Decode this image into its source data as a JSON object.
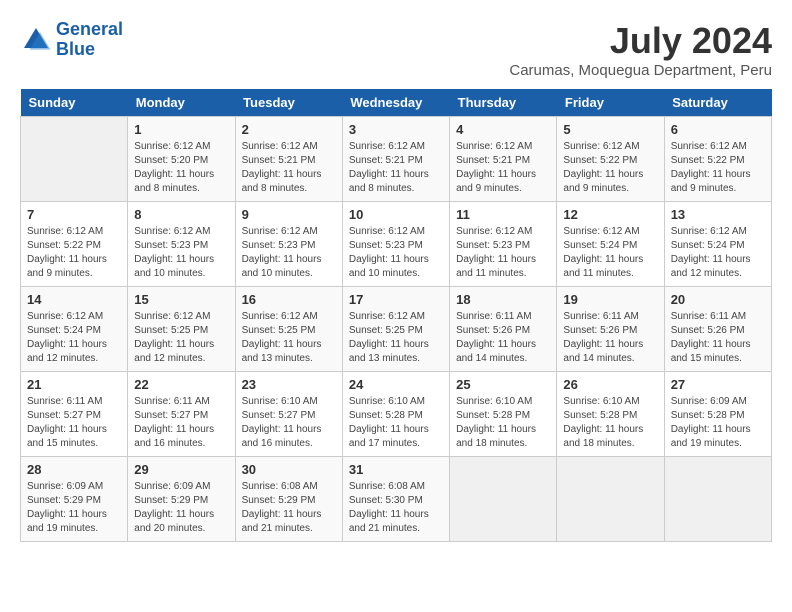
{
  "header": {
    "logo_general": "General",
    "logo_blue": "Blue",
    "month": "July 2024",
    "location": "Carumas, Moquegua Department, Peru"
  },
  "weekdays": [
    "Sunday",
    "Monday",
    "Tuesday",
    "Wednesday",
    "Thursday",
    "Friday",
    "Saturday"
  ],
  "weeks": [
    [
      {
        "day": "",
        "info": ""
      },
      {
        "day": "1",
        "info": "Sunrise: 6:12 AM\nSunset: 5:20 PM\nDaylight: 11 hours\nand 8 minutes."
      },
      {
        "day": "2",
        "info": "Sunrise: 6:12 AM\nSunset: 5:21 PM\nDaylight: 11 hours\nand 8 minutes."
      },
      {
        "day": "3",
        "info": "Sunrise: 6:12 AM\nSunset: 5:21 PM\nDaylight: 11 hours\nand 8 minutes."
      },
      {
        "day": "4",
        "info": "Sunrise: 6:12 AM\nSunset: 5:21 PM\nDaylight: 11 hours\nand 9 minutes."
      },
      {
        "day": "5",
        "info": "Sunrise: 6:12 AM\nSunset: 5:22 PM\nDaylight: 11 hours\nand 9 minutes."
      },
      {
        "day": "6",
        "info": "Sunrise: 6:12 AM\nSunset: 5:22 PM\nDaylight: 11 hours\nand 9 minutes."
      }
    ],
    [
      {
        "day": "7",
        "info": "Sunrise: 6:12 AM\nSunset: 5:22 PM\nDaylight: 11 hours\nand 9 minutes."
      },
      {
        "day": "8",
        "info": "Sunrise: 6:12 AM\nSunset: 5:23 PM\nDaylight: 11 hours\nand 10 minutes."
      },
      {
        "day": "9",
        "info": "Sunrise: 6:12 AM\nSunset: 5:23 PM\nDaylight: 11 hours\nand 10 minutes."
      },
      {
        "day": "10",
        "info": "Sunrise: 6:12 AM\nSunset: 5:23 PM\nDaylight: 11 hours\nand 10 minutes."
      },
      {
        "day": "11",
        "info": "Sunrise: 6:12 AM\nSunset: 5:23 PM\nDaylight: 11 hours\nand 11 minutes."
      },
      {
        "day": "12",
        "info": "Sunrise: 6:12 AM\nSunset: 5:24 PM\nDaylight: 11 hours\nand 11 minutes."
      },
      {
        "day": "13",
        "info": "Sunrise: 6:12 AM\nSunset: 5:24 PM\nDaylight: 11 hours\nand 12 minutes."
      }
    ],
    [
      {
        "day": "14",
        "info": "Sunrise: 6:12 AM\nSunset: 5:24 PM\nDaylight: 11 hours\nand 12 minutes."
      },
      {
        "day": "15",
        "info": "Sunrise: 6:12 AM\nSunset: 5:25 PM\nDaylight: 11 hours\nand 12 minutes."
      },
      {
        "day": "16",
        "info": "Sunrise: 6:12 AM\nSunset: 5:25 PM\nDaylight: 11 hours\nand 13 minutes."
      },
      {
        "day": "17",
        "info": "Sunrise: 6:12 AM\nSunset: 5:25 PM\nDaylight: 11 hours\nand 13 minutes."
      },
      {
        "day": "18",
        "info": "Sunrise: 6:11 AM\nSunset: 5:26 PM\nDaylight: 11 hours\nand 14 minutes."
      },
      {
        "day": "19",
        "info": "Sunrise: 6:11 AM\nSunset: 5:26 PM\nDaylight: 11 hours\nand 14 minutes."
      },
      {
        "day": "20",
        "info": "Sunrise: 6:11 AM\nSunset: 5:26 PM\nDaylight: 11 hours\nand 15 minutes."
      }
    ],
    [
      {
        "day": "21",
        "info": "Sunrise: 6:11 AM\nSunset: 5:27 PM\nDaylight: 11 hours\nand 15 minutes."
      },
      {
        "day": "22",
        "info": "Sunrise: 6:11 AM\nSunset: 5:27 PM\nDaylight: 11 hours\nand 16 minutes."
      },
      {
        "day": "23",
        "info": "Sunrise: 6:10 AM\nSunset: 5:27 PM\nDaylight: 11 hours\nand 16 minutes."
      },
      {
        "day": "24",
        "info": "Sunrise: 6:10 AM\nSunset: 5:28 PM\nDaylight: 11 hours\nand 17 minutes."
      },
      {
        "day": "25",
        "info": "Sunrise: 6:10 AM\nSunset: 5:28 PM\nDaylight: 11 hours\nand 18 minutes."
      },
      {
        "day": "26",
        "info": "Sunrise: 6:10 AM\nSunset: 5:28 PM\nDaylight: 11 hours\nand 18 minutes."
      },
      {
        "day": "27",
        "info": "Sunrise: 6:09 AM\nSunset: 5:28 PM\nDaylight: 11 hours\nand 19 minutes."
      }
    ],
    [
      {
        "day": "28",
        "info": "Sunrise: 6:09 AM\nSunset: 5:29 PM\nDaylight: 11 hours\nand 19 minutes."
      },
      {
        "day": "29",
        "info": "Sunrise: 6:09 AM\nSunset: 5:29 PM\nDaylight: 11 hours\nand 20 minutes."
      },
      {
        "day": "30",
        "info": "Sunrise: 6:08 AM\nSunset: 5:29 PM\nDaylight: 11 hours\nand 21 minutes."
      },
      {
        "day": "31",
        "info": "Sunrise: 6:08 AM\nSunset: 5:30 PM\nDaylight: 11 hours\nand 21 minutes."
      },
      {
        "day": "",
        "info": ""
      },
      {
        "day": "",
        "info": ""
      },
      {
        "day": "",
        "info": ""
      }
    ]
  ]
}
